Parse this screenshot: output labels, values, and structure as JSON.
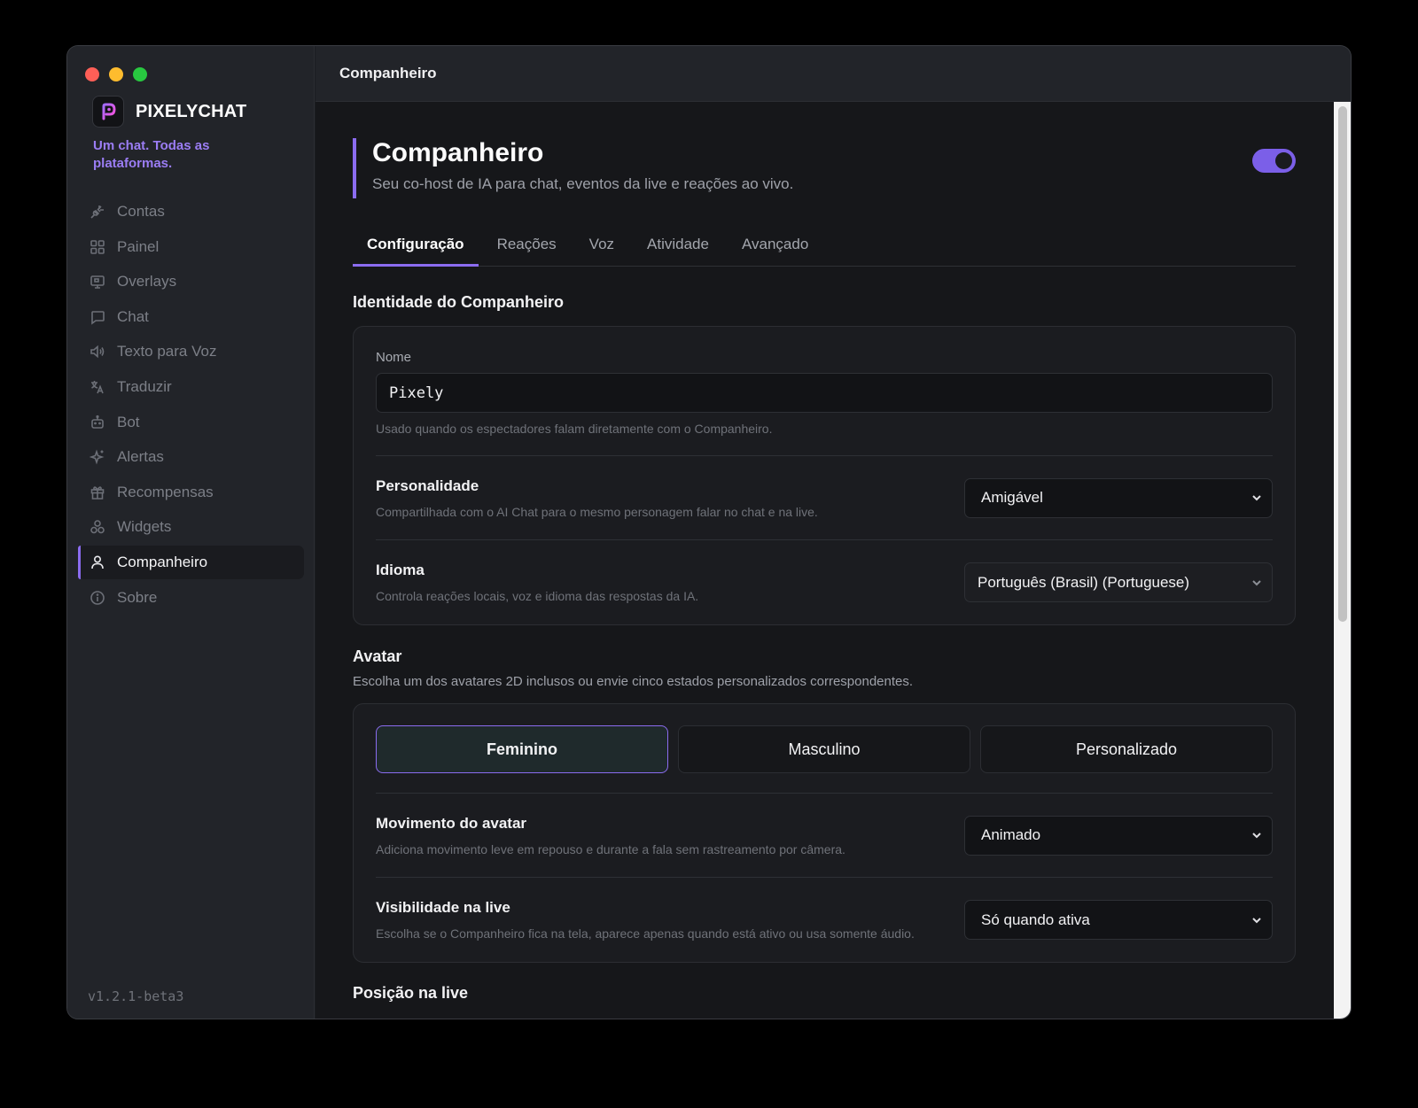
{
  "window": {
    "title": "Companheiro"
  },
  "sidebar": {
    "brand": "PIXELYCHAT",
    "tagline": "Um chat. Todas as plataformas.",
    "items": [
      {
        "label": "Contas",
        "icon": "plug-icon"
      },
      {
        "label": "Painel",
        "icon": "grid-icon"
      },
      {
        "label": "Overlays",
        "icon": "monitor-icon"
      },
      {
        "label": "Chat",
        "icon": "message-icon"
      },
      {
        "label": "Texto para Voz",
        "icon": "speaker-icon"
      },
      {
        "label": "Traduzir",
        "icon": "translate-icon"
      },
      {
        "label": "Bot",
        "icon": "bot-icon"
      },
      {
        "label": "Alertas",
        "icon": "sparkles-icon"
      },
      {
        "label": "Recompensas",
        "icon": "gift-icon"
      },
      {
        "label": "Widgets",
        "icon": "shapes-icon"
      },
      {
        "label": "Companheiro",
        "icon": "user-icon",
        "active": true
      },
      {
        "label": "Sobre",
        "icon": "info-icon"
      }
    ],
    "version": "v1.2.1-beta3"
  },
  "header": {
    "title": "Companheiro",
    "subtitle": "Seu co-host de IA para chat, eventos da live e reações ao vivo.",
    "enabled": true
  },
  "tabs": [
    "Configuração",
    "Reações",
    "Voz",
    "Atividade",
    "Avançado"
  ],
  "identity": {
    "title": "Identidade do Companheiro",
    "name_label": "Nome",
    "name_value": "Pixely",
    "name_hint": "Usado quando os espectadores falam diretamente com o Companheiro.",
    "personality_label": "Personalidade",
    "personality_desc": "Compartilhada com o AI Chat para o mesmo personagem falar no chat e na live.",
    "personality_value": "Amigável",
    "language_label": "Idioma",
    "language_desc": "Controla reações locais, voz e idioma das respostas da IA.",
    "language_value": "Português (Brasil) (Portuguese)"
  },
  "avatar": {
    "title": "Avatar",
    "desc": "Escolha um dos avatares 2D inclusos ou envie cinco estados personalizados correspondentes.",
    "options": [
      "Feminino",
      "Masculino",
      "Personalizado"
    ],
    "selected": "Feminino",
    "motion_label": "Movimento do avatar",
    "motion_desc": "Adiciona movimento leve em repouso e durante a fala sem rastreamento por câmera.",
    "motion_value": "Animado",
    "visibility_label": "Visibilidade na live",
    "visibility_desc": "Escolha se o Companheiro fica na tela, aparece apenas quando está ativo ou usa somente áudio.",
    "visibility_value": "Só quando ativa"
  },
  "position": {
    "title": "Posição na live"
  },
  "colors": {
    "accent": "#8b6cf0",
    "background": "#16171a",
    "sidebar": "#222429"
  }
}
